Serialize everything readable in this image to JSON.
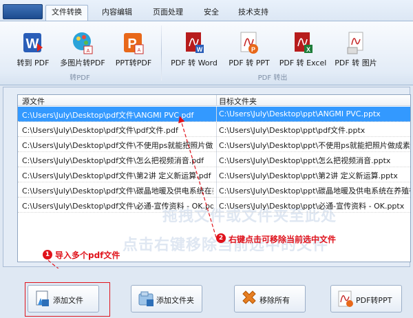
{
  "tabs": [
    {
      "label": "文件转换"
    },
    {
      "label": "内容编辑"
    },
    {
      "label": "页面处理"
    },
    {
      "label": "安全"
    },
    {
      "label": "技术支持"
    }
  ],
  "ribbon": {
    "group_to_pdf": {
      "caption": "转PDF",
      "buttons": [
        {
          "label": "转到 PDF",
          "icon": "word-to-pdf-icon"
        },
        {
          "label": "多图片转PDF",
          "icon": "images-to-pdf-icon"
        },
        {
          "label": "PPT转PDF",
          "icon": "ppt-to-pdf-icon"
        }
      ]
    },
    "group_from_pdf": {
      "caption": "PDF 转出",
      "buttons": [
        {
          "label": "PDF 转 Word",
          "icon": "pdf-to-word-icon"
        },
        {
          "label": "PDF 转 PPT",
          "icon": "pdf-to-ppt-icon"
        },
        {
          "label": "PDF 转 Excel",
          "icon": "pdf-to-excel-icon"
        },
        {
          "label": "PDF 转 图片",
          "icon": "pdf-to-image-icon"
        }
      ]
    }
  },
  "file_list": {
    "columns": {
      "source": "源文件",
      "target": "目标文件夹"
    },
    "rows": [
      {
        "source": "C:\\Users\\July\\Desktop\\pdf文件\\ANGMI PVC.pdf",
        "target": "C:\\Users\\July\\Desktop\\ppt\\ANGMI PVC.pptx",
        "selected": true
      },
      {
        "source": "C:\\Users\\July\\Desktop\\pdf文件\\pdf文件.pdf",
        "target": "C:\\Users\\July\\Desktop\\ppt\\pdf文件.pptx"
      },
      {
        "source": "C:\\Users\\July\\Desktop\\pdf文件\\不使用ps就能把照片做成",
        "target": "C:\\Users\\July\\Desktop\\ppt\\不使用ps就能把照片做成素描效"
      },
      {
        "source": "C:\\Users\\July\\Desktop\\pdf文件\\怎么把视频消音.pdf",
        "target": "C:\\Users\\July\\Desktop\\ppt\\怎么把视频消音.pptx"
      },
      {
        "source": "C:\\Users\\July\\Desktop\\pdf文件\\第2讲 定义新运算.pdf",
        "target": "C:\\Users\\July\\Desktop\\ppt\\第2讲 定义新运算.pptx"
      },
      {
        "source": "C:\\Users\\July\\Desktop\\pdf文件\\碳晶地暖及供电系统在养",
        "target": "C:\\Users\\July\\Desktop\\ppt\\碳晶地暖及供电系统在养殖行业"
      },
      {
        "source": "C:\\Users\\July\\Desktop\\pdf文件\\必通-宣传资料 - OK.pdf",
        "target": "C:\\Users\\July\\Desktop\\ppt\\必通-宣传资料 - OK.pptx"
      }
    ],
    "watermark_line1": "拖拽文件或文件夹至此处",
    "watermark_line2": "点击右键移除当前选中的文件"
  },
  "annotations": {
    "step1": {
      "number": "1",
      "text": "导入多个pdf文件"
    },
    "step2": {
      "number": "2",
      "text": "右键点击可移除当前选中文件"
    },
    "color": "#e0121b"
  },
  "bottom_buttons": [
    {
      "label": "添加文件",
      "icon": "add-file-icon"
    },
    {
      "label": "添加文件夹",
      "icon": "add-folder-icon"
    },
    {
      "label": "移除所有",
      "icon": "remove-all-icon"
    },
    {
      "label": "PDF转PPT",
      "icon": "pdf-to-ppt-icon"
    }
  ]
}
